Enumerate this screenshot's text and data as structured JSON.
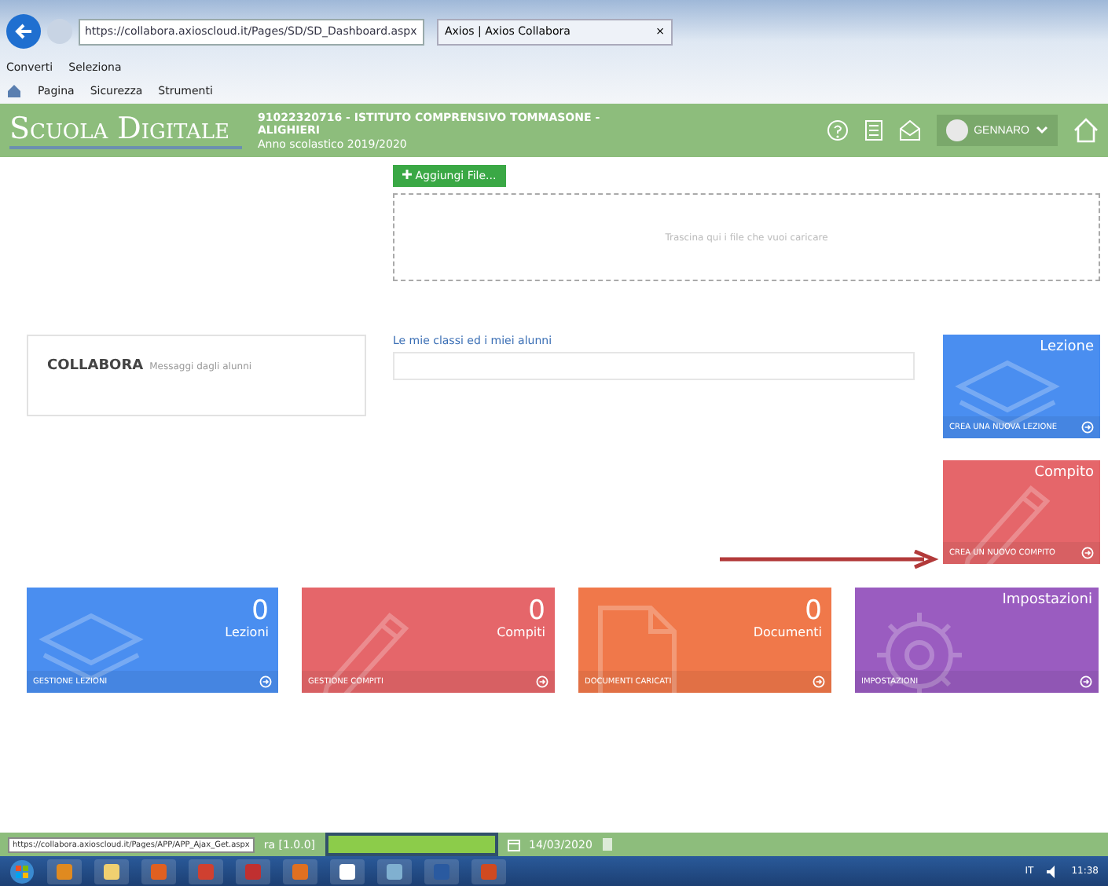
{
  "browser": {
    "address": "https://collabora.axioscloud.it/Pages/SD/SD_Dashboard.aspx",
    "tab": "Axios | Axios Collabora",
    "tab_close": "×",
    "commands": [
      "Converti",
      "Seleziona"
    ],
    "menus": [
      "Pagina",
      "Sicurezza",
      "Strumenti"
    ]
  },
  "header": {
    "logo": "Scuola Digitale",
    "school": "91022320716 - ISTITUTO COMPRENSIVO TOMMASONE - ALIGHIERI",
    "year": "Anno scolastico 2019/2020",
    "user": "GENNARO"
  },
  "upload": {
    "button": "Aggiungi File...",
    "dropzone": "Trascina qui i file che vuoi caricare"
  },
  "collabora": {
    "title": "COLLABORA",
    "subtitle": "Messaggi dagli alunni"
  },
  "classes": {
    "label": "Le mie classi ed i miei alunni"
  },
  "action_tiles": [
    {
      "kind": "layers",
      "title": "Lezione",
      "link": "CREA UNA NUOVA LEZIONE",
      "color": "#4a8ef0"
    },
    {
      "kind": "pencil",
      "title": "Compito",
      "link": "CREA UN NUOVO COMPITO",
      "color": "#e5666a"
    }
  ],
  "summary_tiles": [
    {
      "kind": "layers",
      "count": "0",
      "label": "Lezioni",
      "link": "GESTIONE LEZIONI",
      "color": "#4a8ef0"
    },
    {
      "kind": "pencil",
      "count": "0",
      "label": "Compiti",
      "link": "GESTIONE COMPITI",
      "color": "#e5666a"
    },
    {
      "kind": "document",
      "count": "0",
      "label": "Documenti",
      "link": "DOCUMENTI CARICATI",
      "color": "#f0784a"
    },
    {
      "kind": "gear",
      "label": "Impostazioni",
      "link": "IMPOSTAZIONI",
      "color": "#9a5cc0"
    }
  ],
  "footer": {
    "url": "https://collabora.axioscloud.it/Pages/APP/APP_Ajax_Get.aspx",
    "version": "ra [1.0.0]",
    "date": "14/03/2020"
  },
  "taskbar": {
    "language": "IT",
    "time": "11:38"
  }
}
